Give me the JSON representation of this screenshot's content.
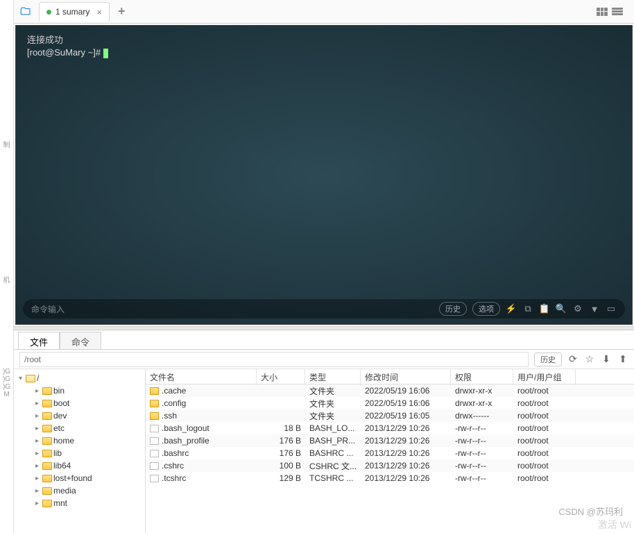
{
  "tab": {
    "label": "1 sumary"
  },
  "terminal": {
    "connected": "连接成功",
    "prompt": "[root@SuMary ~]# "
  },
  "cmdbar": {
    "placeholder": "命令输入",
    "history": "历史",
    "options": "选项"
  },
  "bottom_tabs": {
    "file": "文件",
    "cmd": "命令"
  },
  "path": {
    "value": "/root",
    "history": "历史"
  },
  "tree": {
    "root": "/",
    "items": [
      "bin",
      "boot",
      "dev",
      "etc",
      "home",
      "lib",
      "lib64",
      "lost+found",
      "media",
      "mnt"
    ]
  },
  "columns": {
    "name": "文件名",
    "size": "大小",
    "type": "类型",
    "mtime": "修改时间",
    "perm": "权限",
    "owner": "用户/用户组"
  },
  "files": [
    {
      "name": ".cache",
      "size": "",
      "type": "文件夹",
      "mtime": "2022/05/19 16:06",
      "perm": "drwxr-xr-x",
      "owner": "root/root",
      "kind": "folder"
    },
    {
      "name": ".config",
      "size": "",
      "type": "文件夹",
      "mtime": "2022/05/19 16:06",
      "perm": "drwxr-xr-x",
      "owner": "root/root",
      "kind": "folder"
    },
    {
      "name": ".ssh",
      "size": "",
      "type": "文件夹",
      "mtime": "2022/05/19 16:05",
      "perm": "drwx------",
      "owner": "root/root",
      "kind": "folder"
    },
    {
      "name": ".bash_logout",
      "size": "18 B",
      "type": "BASH_LO...",
      "mtime": "2013/12/29 10:26",
      "perm": "-rw-r--r--",
      "owner": "root/root",
      "kind": "file"
    },
    {
      "name": ".bash_profile",
      "size": "176 B",
      "type": "BASH_PR...",
      "mtime": "2013/12/29 10:26",
      "perm": "-rw-r--r--",
      "owner": "root/root",
      "kind": "file"
    },
    {
      "name": ".bashrc",
      "size": "176 B",
      "type": "BASHRC ...",
      "mtime": "2013/12/29 10:26",
      "perm": "-rw-r--r--",
      "owner": "root/root",
      "kind": "file"
    },
    {
      "name": ".cshrc",
      "size": "100 B",
      "type": "CSHRC 文...",
      "mtime": "2013/12/29 10:26",
      "perm": "-rw-r--r--",
      "owner": "root/root",
      "kind": "file"
    },
    {
      "name": ".tcshrc",
      "size": "129 B",
      "type": "TCSHRC ...",
      "mtime": "2013/12/29 10:26",
      "perm": "-rw-r--r--",
      "owner": "root/root",
      "kind": "file"
    }
  ],
  "watermark": "CSDN @苏玛利",
  "watermark2": "激活 Wi",
  "leftstrip": [
    "制",
    "",
    "",
    "机",
    "",
    "G",
    "G",
    "G",
    "M"
  ]
}
